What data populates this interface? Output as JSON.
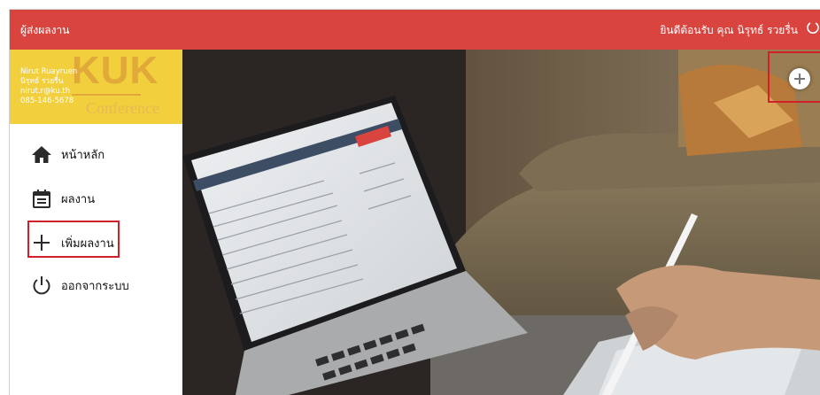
{
  "header": {
    "app_title": "ผู้ส่งผลงาน",
    "welcome": "ยินดีต้อนรับ คุณ นิรุทธ์ รวยรื่น"
  },
  "profile": {
    "logo": "KUK",
    "logo_sub": "Conference",
    "name_en": "Nirut Ruayruen",
    "name_th": "นิรุทธ์ รวยรื่น",
    "email": "nirut.r@ku.th",
    "phone": "085-146-5678"
  },
  "nav": {
    "items": [
      {
        "label": "หน้าหลัก",
        "icon": "home-icon"
      },
      {
        "label": "ผลงาน",
        "icon": "calendar-icon"
      },
      {
        "label": "เพิ่มผลงาน",
        "icon": "plus-icon"
      },
      {
        "label": "ออกจากระบบ",
        "icon": "power-icon"
      }
    ]
  },
  "fab": {
    "icon": "plus-icon"
  },
  "colors": {
    "header": "#d9443f",
    "profile_bg": "#f2cf3c",
    "highlight": "#d0202a"
  }
}
